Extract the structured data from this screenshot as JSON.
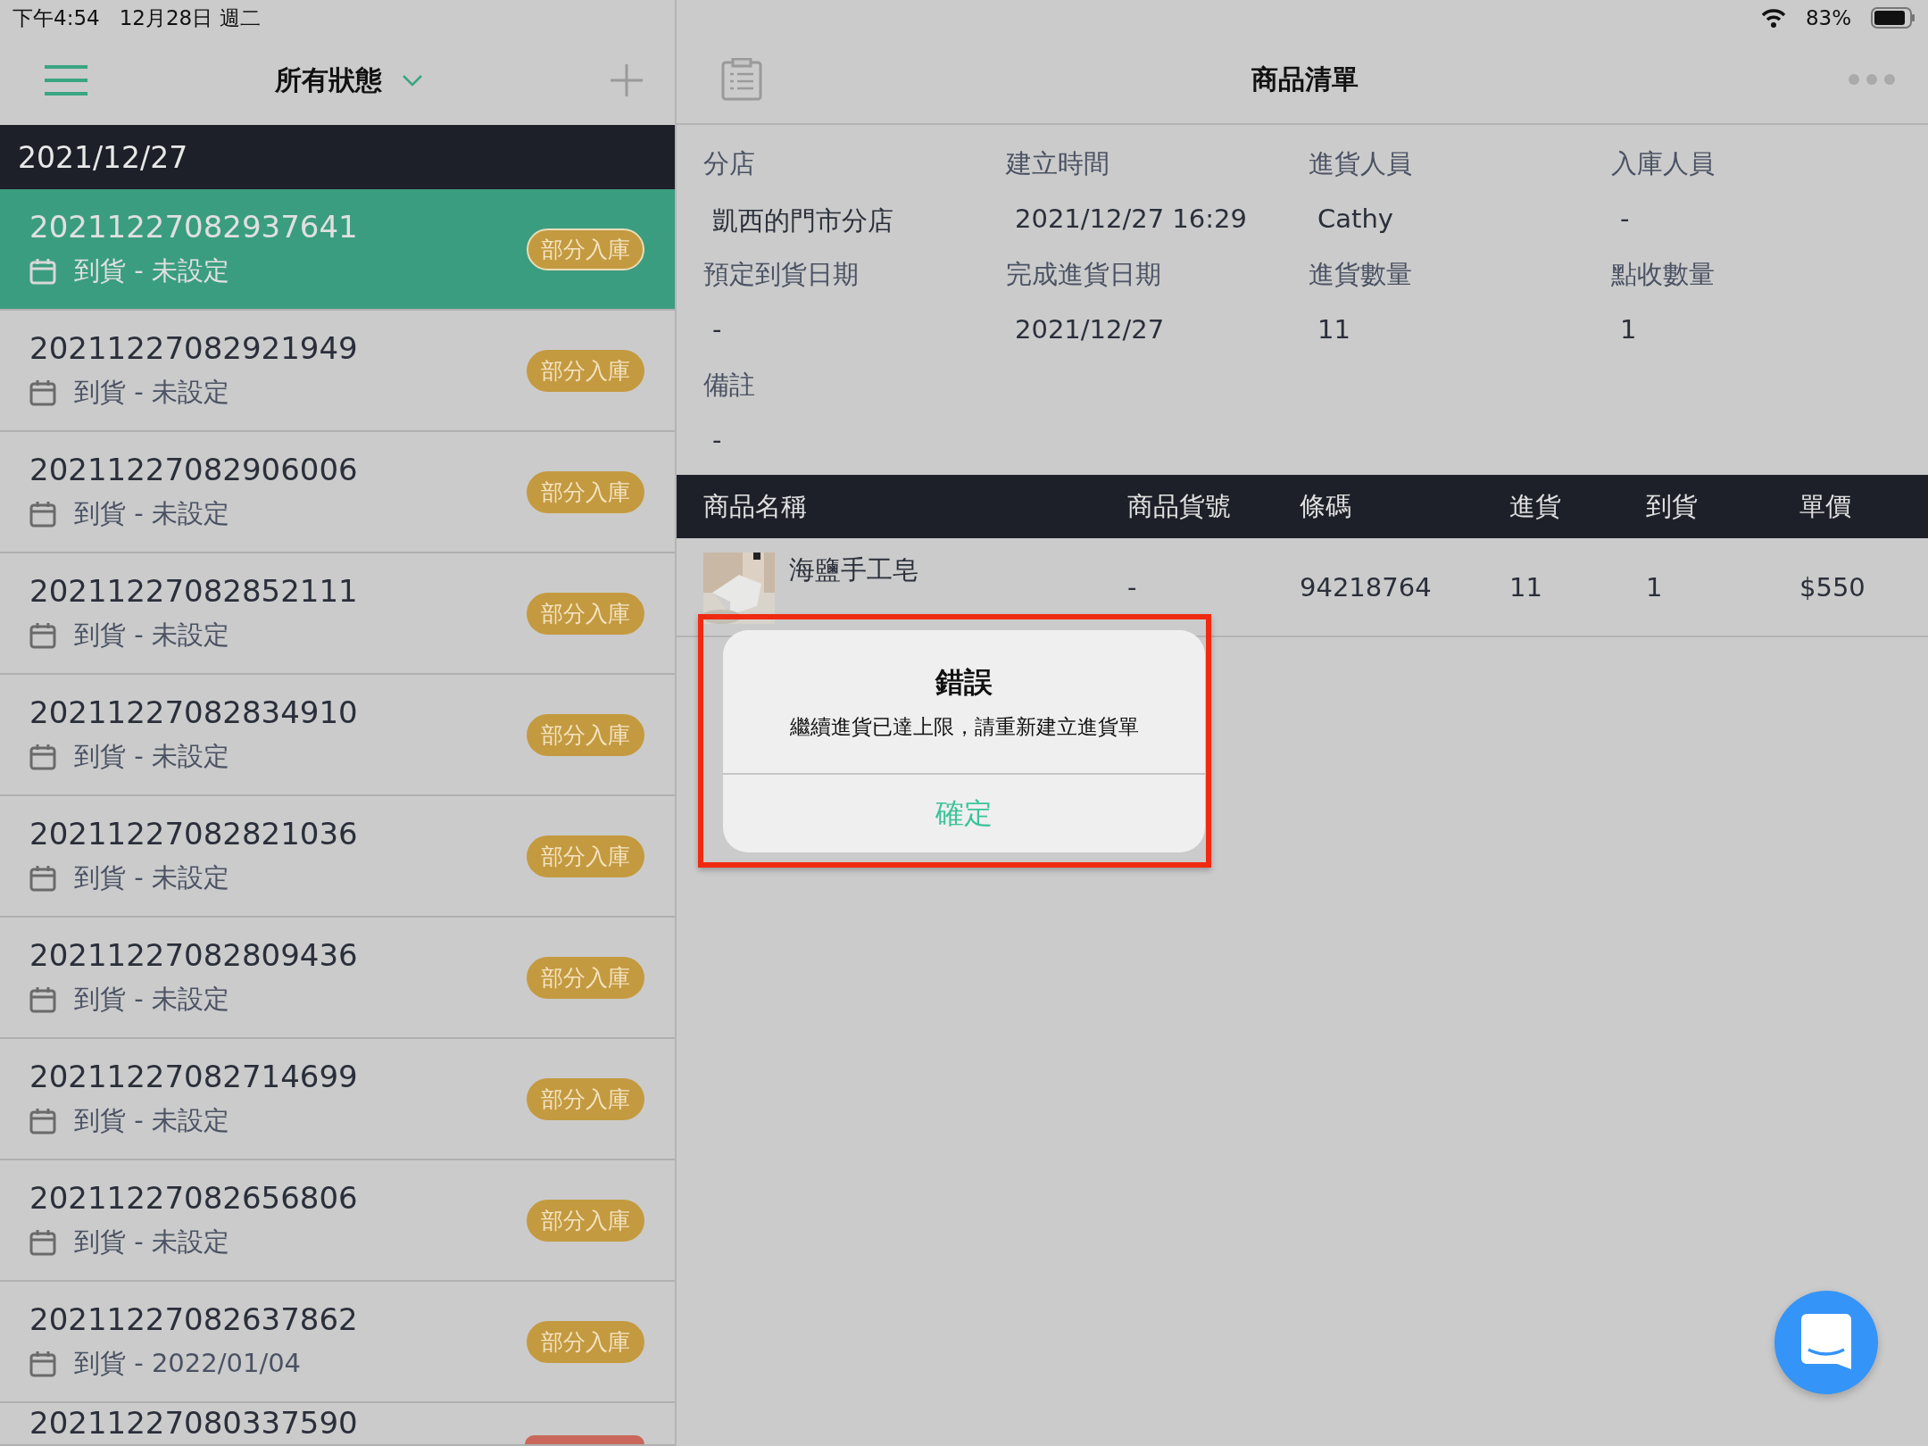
{
  "status_bar": {
    "time": "下午4:54",
    "date": "12月28日 週二",
    "battery": "83%"
  },
  "sidebar": {
    "title": "所有狀態",
    "date_header": "2021/12/27",
    "items": [
      {
        "order_no": "20211227082937641",
        "arrival": "到貨 - 未設定",
        "badge": "部分入庫",
        "color": "#c49a40",
        "selected": true
      },
      {
        "order_no": "20211227082921949",
        "arrival": "到貨 - 未設定",
        "badge": "部分入庫",
        "color": "#c49a40",
        "selected": false
      },
      {
        "order_no": "20211227082906006",
        "arrival": "到貨 - 未設定",
        "badge": "部分入庫",
        "color": "#c49a40",
        "selected": false
      },
      {
        "order_no": "20211227082852111",
        "arrival": "到貨 - 未設定",
        "badge": "部分入庫",
        "color": "#c49a40",
        "selected": false
      },
      {
        "order_no": "20211227082834910",
        "arrival": "到貨 - 未設定",
        "badge": "部分入庫",
        "color": "#c49a40",
        "selected": false
      },
      {
        "order_no": "20211227082821036",
        "arrival": "到貨 - 未設定",
        "badge": "部分入庫",
        "color": "#c49a40",
        "selected": false
      },
      {
        "order_no": "20211227082809436",
        "arrival": "到貨 - 未設定",
        "badge": "部分入庫",
        "color": "#c49a40",
        "selected": false
      },
      {
        "order_no": "20211227082714699",
        "arrival": "到貨 - 未設定",
        "badge": "部分入庫",
        "color": "#c49a40",
        "selected": false
      },
      {
        "order_no": "20211227082656806",
        "arrival": "到貨 - 未設定",
        "badge": "部分入庫",
        "color": "#c49a40",
        "selected": false
      },
      {
        "order_no": "20211227082637862",
        "arrival": "到貨 - 2022/01/04",
        "badge": "部分入庫",
        "color": "#c49a40",
        "selected": false
      },
      {
        "order_no": "20211227080337590",
        "color": "#c9685a",
        "selected": false
      }
    ]
  },
  "detail": {
    "title": "商品清單",
    "fields": [
      {
        "label": "分店",
        "value": "凱西的門市分店"
      },
      {
        "label": "建立時間",
        "value": "2021/12/27 16:29"
      },
      {
        "label": "進貨人員",
        "value": "Cathy"
      },
      {
        "label": "入庫人員",
        "value": "-"
      },
      {
        "label": "預定到貨日期",
        "value": "-"
      },
      {
        "label": "完成進貨日期",
        "value": "2021/12/27"
      },
      {
        "label": "進貨數量",
        "value": "11"
      },
      {
        "label": "點收數量",
        "value": "1"
      },
      {
        "label": "備註",
        "value": "-"
      }
    ],
    "table": {
      "columns": [
        "商品名稱",
        "商品貨號",
        "條碼",
        "進貨",
        "到貨",
        "單價"
      ],
      "rows": [
        {
          "cells": [
            "海鹽手工皂",
            "-",
            "94218764",
            "11",
            "1",
            "$550"
          ]
        }
      ]
    }
  },
  "dialog": {
    "title": "錯誤",
    "message": "繼續進貨已達上限，請重新建立進貨單",
    "button": "確定",
    "highlighted": true
  }
}
